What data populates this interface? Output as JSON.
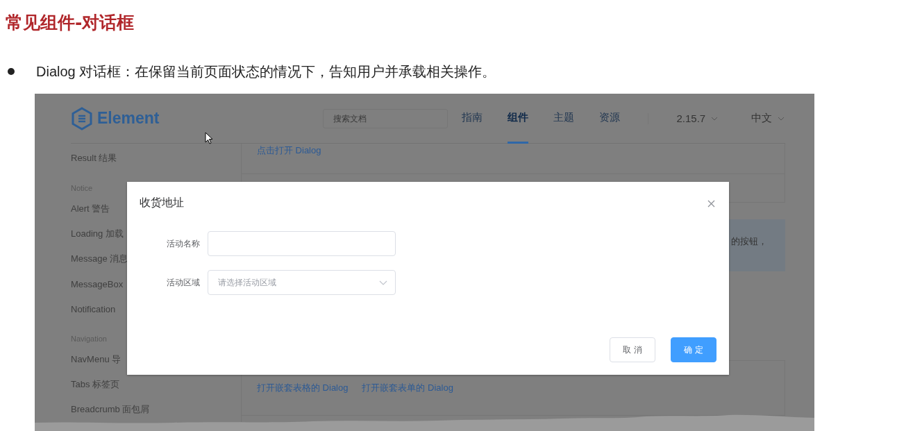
{
  "slide": {
    "title": "常见组件-对话框",
    "bullet": "Dialog 对话框：在保留当前页面状态的情况下，告知用户并承载相关操作。"
  },
  "header": {
    "logo_text": "Element",
    "search_placeholder": "搜索文档",
    "version": "2.15.7",
    "language": "中文"
  },
  "nav": [
    {
      "label": "指南",
      "selected": false
    },
    {
      "label": "组件",
      "selected": true
    },
    {
      "label": "主题",
      "selected": false
    },
    {
      "label": "资源",
      "selected": false
    }
  ],
  "sidebar": [
    {
      "kind": "item",
      "label": "Result 结果"
    },
    {
      "kind": "group",
      "label": "Notice"
    },
    {
      "kind": "item",
      "label": "Alert 警告"
    },
    {
      "kind": "item",
      "label": "Loading 加载"
    },
    {
      "kind": "item",
      "label": "Message 消息"
    },
    {
      "kind": "item",
      "label": "MessageBox"
    },
    {
      "kind": "item",
      "label": "Notification"
    },
    {
      "kind": "group",
      "label": "Navigation"
    },
    {
      "kind": "item",
      "label": "NavMenu 导"
    },
    {
      "kind": "item",
      "label": "Tabs 标签页"
    },
    {
      "kind": "item",
      "label": "Breadcrumb 面包屑"
    }
  ],
  "content": {
    "open_link": "点击打开 Dialog",
    "tip_text": "的按钮，",
    "links": [
      "打开嵌套表格的 Dialog",
      "打开嵌套表单的 Dialog"
    ]
  },
  "dialog": {
    "title": "收货地址",
    "fields": [
      {
        "kind": "input",
        "label": "活动名称"
      },
      {
        "kind": "select",
        "label": "活动区域",
        "placeholder": "请选择活动区域"
      }
    ],
    "buttons": [
      {
        "kind": "default",
        "label": "取 消"
      },
      {
        "kind": "primary",
        "label": "确 定"
      }
    ]
  }
}
